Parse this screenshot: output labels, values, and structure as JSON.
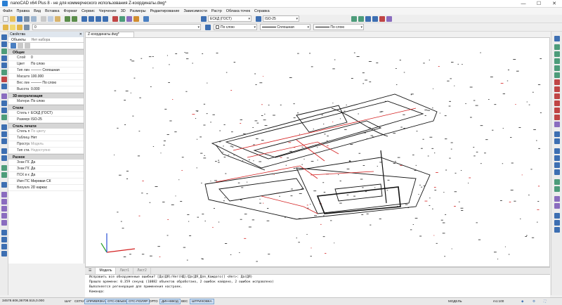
{
  "window": {
    "title": "nanoCAD x64 Plus 8 - не для коммерческого использования Z-координаты.dwg*",
    "minimize": "—",
    "maximize": "☐",
    "close": "✕"
  },
  "menu": [
    "Файл",
    "Правка",
    "Вид",
    "Вставка",
    "Формат",
    "Сервис",
    "Черчение",
    "3D",
    "Размеры",
    "Редактирование",
    "Зависимости",
    "Растр",
    "Облака точек",
    "Справка"
  ],
  "toolbar": {
    "text_style": "ЕСКД (ГОСТ)",
    "dim_style": "ISO-25",
    "layer": "0",
    "color": "По слою",
    "linetype": "Сплошная",
    "lineweight": "По слою"
  },
  "properties": {
    "title": "Свойства",
    "close": "✕",
    "tab_objects": "Объекты",
    "tab_selection": "Нет набора",
    "sections": [
      {
        "name": "Общие",
        "rows": [
          {
            "key": "Слой",
            "value": "0"
          },
          {
            "key": "Цвет",
            "value": "По слою"
          },
          {
            "key": "Тип линий",
            "value": "——— Сплошная"
          },
          {
            "key": "Масштаб ...",
            "value": "100.000"
          },
          {
            "key": "Вес линий",
            "value": "——— По слою"
          },
          {
            "key": "Высота 3D",
            "value": "0.000"
          }
        ]
      },
      {
        "name": "3D-визуализация",
        "rows": [
          {
            "key": "Материал",
            "value": "По слою"
          }
        ]
      },
      {
        "name": "Стили",
        "rows": [
          {
            "key": "Стиль тек...",
            "value": "ЕСКД (ГОСТ)"
          },
          {
            "key": "Размерн...",
            "value": "ISO-25"
          }
        ]
      },
      {
        "name": "Стиль печати",
        "rows": [
          {
            "key": "Стиль печ...",
            "value": "По цвету",
            "grey": true
          },
          {
            "key": "Таблица с...",
            "value": "Нет"
          },
          {
            "key": "Простран...",
            "value": "Модель",
            "grey": true
          },
          {
            "key": "Тип стиле...",
            "value": "Недоступно",
            "grey": true
          }
        ]
      },
      {
        "name": "Разное",
        "rows": [
          {
            "key": "Знак ПСК ...",
            "value": "Да"
          },
          {
            "key": "Знак ПСК ...",
            "value": "Да"
          },
          {
            "key": "ПСК в ка...",
            "value": "Да"
          },
          {
            "key": "Имя ПСК",
            "value": "Мировая СК"
          },
          {
            "key": "Визуальн...",
            "value": "2D каркас"
          }
        ]
      }
    ]
  },
  "document_tab": "Z-координаты.dwg*",
  "layout_tabs": [
    "Модель",
    "Лист1",
    "Лист2"
  ],
  "command_lines": [
    "Исправить все обнаруженные ошибки? [Да(ДЯ)/Нет(НД)/Да(ДЯ_Для_Каждого)] <Нет>: Да(ДЯ)",
    "Прошло времени: 0.359 секунд (10882 объектов обработано, 2 ошибок найдено, 2 ошибок исправлено)",
    "Выполняется регенерация для применения настроек.",
    "Команда:"
  ],
  "status": {
    "coords": "34578.606,36708.515,0.000",
    "toggles": [
      {
        "label": "ШАГ",
        "on": false
      },
      {
        "label": "СЕТКА",
        "on": false
      },
      {
        "label": "оПРИВЯЗКА",
        "on": true
      },
      {
        "label": "ОТС-ОБЪЕКТ",
        "on": true
      },
      {
        "label": "ОТС-ПОЛЯР",
        "on": true
      },
      {
        "label": "ОРТО",
        "on": false
      },
      {
        "label": "ДИН-ВВОД",
        "on": true
      },
      {
        "label": "ВЕС",
        "on": false
      },
      {
        "label": "ШТРИХОВКА",
        "on": true
      }
    ],
    "space": "МОДЕЛЬ",
    "scale": "m1:100"
  },
  "colors": {
    "accent": "#2a7fd4",
    "toggle_on": "#cfe0f4",
    "drawing_red": "#d42020"
  }
}
